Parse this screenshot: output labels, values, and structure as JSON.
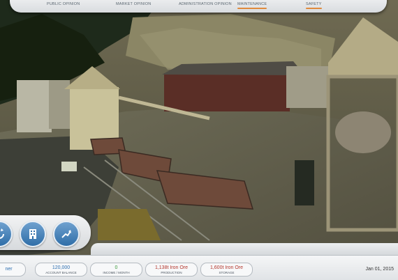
{
  "top_menu": {
    "items": [
      {
        "label": "PUBLIC OPINION",
        "active": false
      },
      {
        "label": "MARKET OPINION",
        "active": false
      },
      {
        "label": "ADMINISTRATION OPINION",
        "active": false
      },
      {
        "label": "MAINTENANCE",
        "active": true
      },
      {
        "label": "SAFETY",
        "active": true
      }
    ]
  },
  "toolbar": {
    "buttons": [
      {
        "icon": "rotate-icon"
      },
      {
        "icon": "building-icon"
      },
      {
        "icon": "trend-chart-icon"
      }
    ]
  },
  "status_bar": {
    "partial_label": "ner",
    "account_balance": {
      "value": "120,000",
      "label": "ACCOUNT BALANCE"
    },
    "income": {
      "value": "0",
      "label": "INCOME / MONTH"
    },
    "production": {
      "value": "1,138t Iron Ore",
      "label": "PRODUCTION"
    },
    "storage": {
      "value": "1,600t Iron Ore",
      "label": "STORAGE"
    },
    "date": "Jan 01, 2015"
  },
  "colors": {
    "accent": "#e08a3c",
    "button_blue": "#2f6ea8",
    "value_blue": "#2e6fb0",
    "value_green": "#3c9a3a",
    "value_red": "#b4352b"
  }
}
